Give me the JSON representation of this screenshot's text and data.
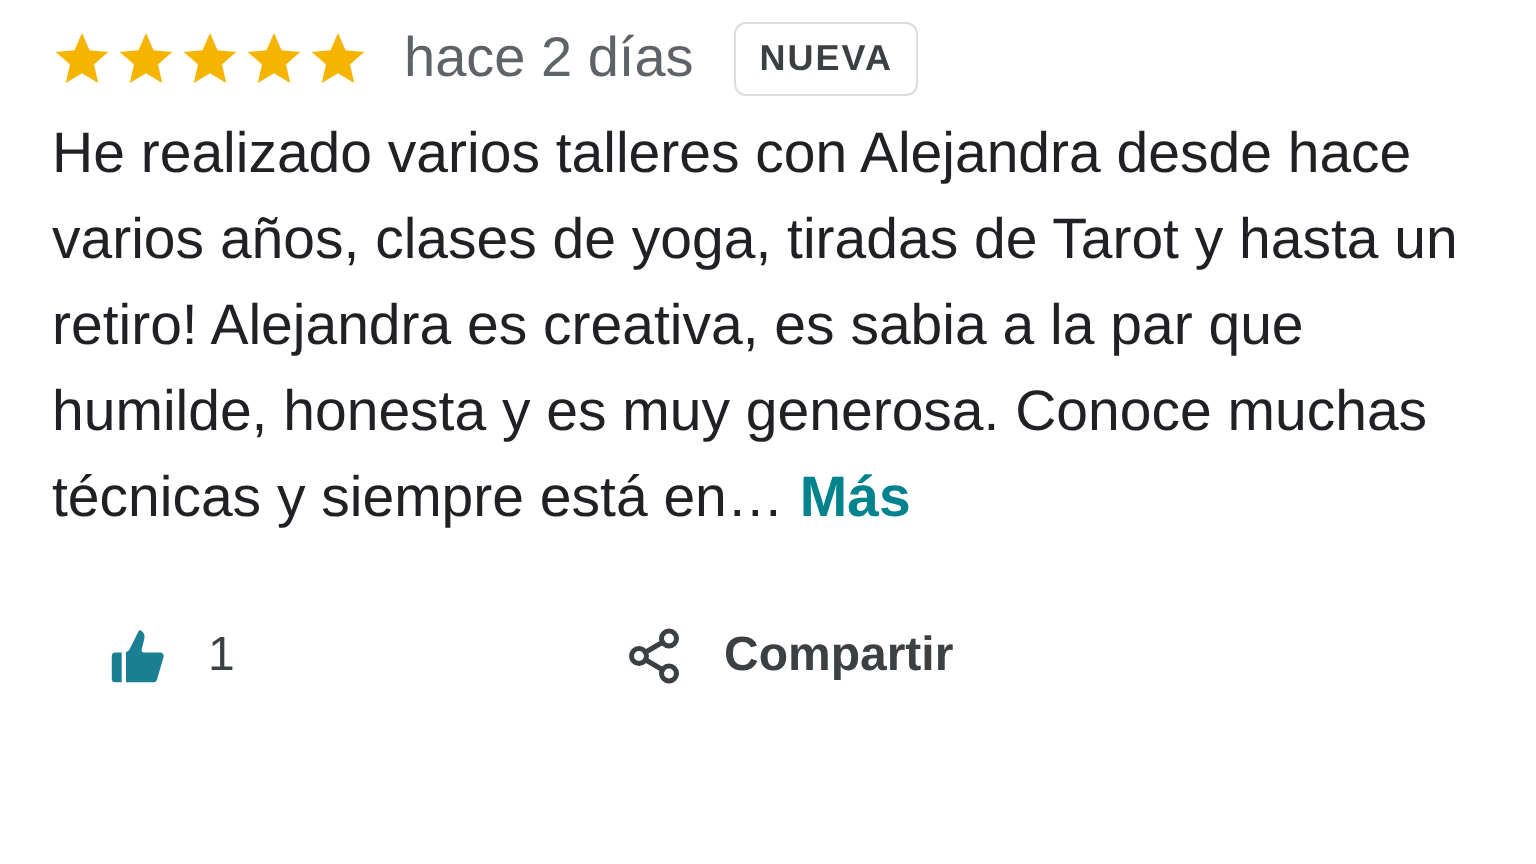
{
  "review": {
    "stars": 5,
    "time": "hace 2 días",
    "badge": "NUEVA",
    "text": "He realizado varios talleres con Alejandra desde hace varios años, clases de yoga, tiradas de Tarot y hasta un retiro! Alejandra es creativa, es sabia a la par que humilde, honesta y es muy generosa. Conoce muchas técnicas y siempre está en…",
    "more": "Más"
  },
  "actions": {
    "likes": "1",
    "share": "Compartir"
  }
}
